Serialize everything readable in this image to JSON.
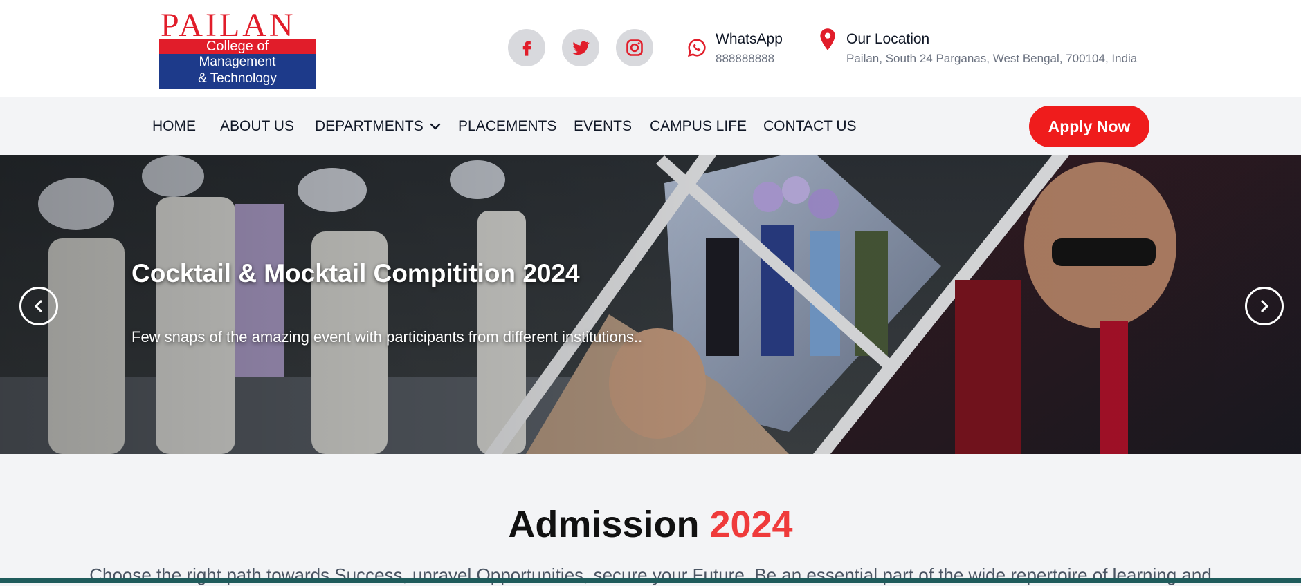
{
  "brand": {
    "name": "PAILAN",
    "line1": "College of",
    "line2": "Management",
    "line3": "& Technology"
  },
  "header": {
    "social": [
      {
        "icon": "facebook-icon"
      },
      {
        "icon": "twitter-icon"
      },
      {
        "icon": "instagram-icon"
      }
    ],
    "whatsapp": {
      "icon": "whatsapp-icon",
      "title": "WhatsApp",
      "number": "888888888"
    },
    "location": {
      "icon": "location-pin-icon",
      "title": "Our Location",
      "address": "Pailan, South 24 Parganas, West Bengal, 700104, India"
    }
  },
  "nav": {
    "items": [
      {
        "label": "HOME"
      },
      {
        "label": "ABOUT US"
      },
      {
        "label": "DEPARTMENTS"
      },
      {
        "label": "PLACEMENTS"
      },
      {
        "label": "EVENTS"
      },
      {
        "label": "CAMPUS LIFE"
      },
      {
        "label": "CONTACT US"
      }
    ],
    "apply_label": "Apply Now"
  },
  "hero": {
    "title": "Cocktail & Mocktail Compitition 2024",
    "subtitle": "Few snaps of the amazing event with participants from different institutions.."
  },
  "admission": {
    "title_word": "Admission",
    "title_year": "2024",
    "text": "Choose the right path towards Success, unravel Opportunities, secure your Future. Be an essential part of the wide repertoire of learning and"
  },
  "colors": {
    "accent": "#ef1c1c",
    "brand_red": "#e11d2a",
    "brand_blue": "#1d3a8a",
    "year_red": "#ef3b3b"
  }
}
